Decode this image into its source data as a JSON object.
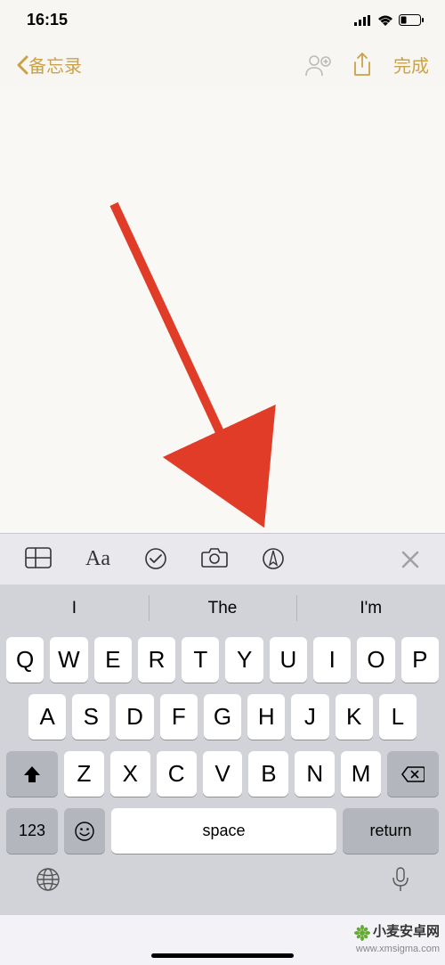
{
  "status": {
    "time": "16:15"
  },
  "nav": {
    "back_label": "备忘录",
    "done_label": "完成"
  },
  "toolbar_icons": [
    "table",
    "text-format",
    "checklist",
    "camera",
    "markup"
  ],
  "suggestions": [
    "I",
    "The",
    "I'm"
  ],
  "keyboard": {
    "row1": [
      "Q",
      "W",
      "E",
      "R",
      "T",
      "Y",
      "U",
      "I",
      "O",
      "P"
    ],
    "row2": [
      "A",
      "S",
      "D",
      "F",
      "G",
      "H",
      "J",
      "K",
      "L"
    ],
    "row3": [
      "Z",
      "X",
      "C",
      "V",
      "B",
      "N",
      "M"
    ],
    "numbers_key": "123",
    "space_label": "space",
    "return_label": "return"
  },
  "watermark": {
    "brand": "小麦安卓网",
    "url": "www.xmsigma.com"
  }
}
